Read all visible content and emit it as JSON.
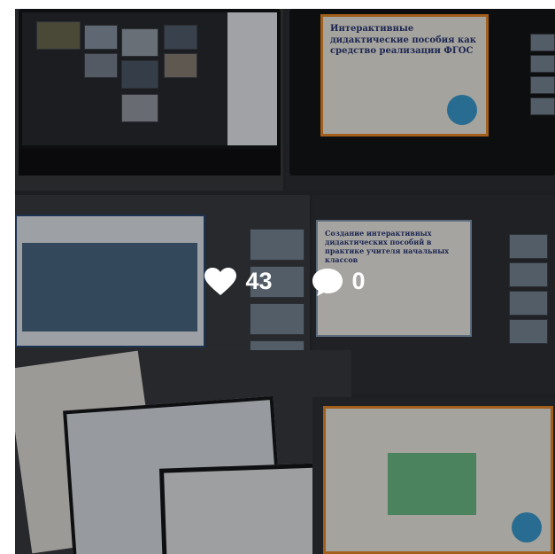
{
  "post": {
    "likes": "43",
    "comments": "0",
    "like_icon": "heart-icon",
    "comment_icon": "speech-bubble-icon"
  },
  "collage": {
    "slide_top_right_title": "Интерактивные дидактические пособия как средство реализации ФГОС",
    "slide_top_right_sub": "",
    "slide_mid_left_title": "",
    "slide_mid_right_title": "Создание интерактивных дидактических пособий в практике учителя начальных классов"
  },
  "colors": {
    "accent": "#f08c2a",
    "overlay": "rgba(0,0,0,0.32)",
    "text": "#ffffff"
  }
}
